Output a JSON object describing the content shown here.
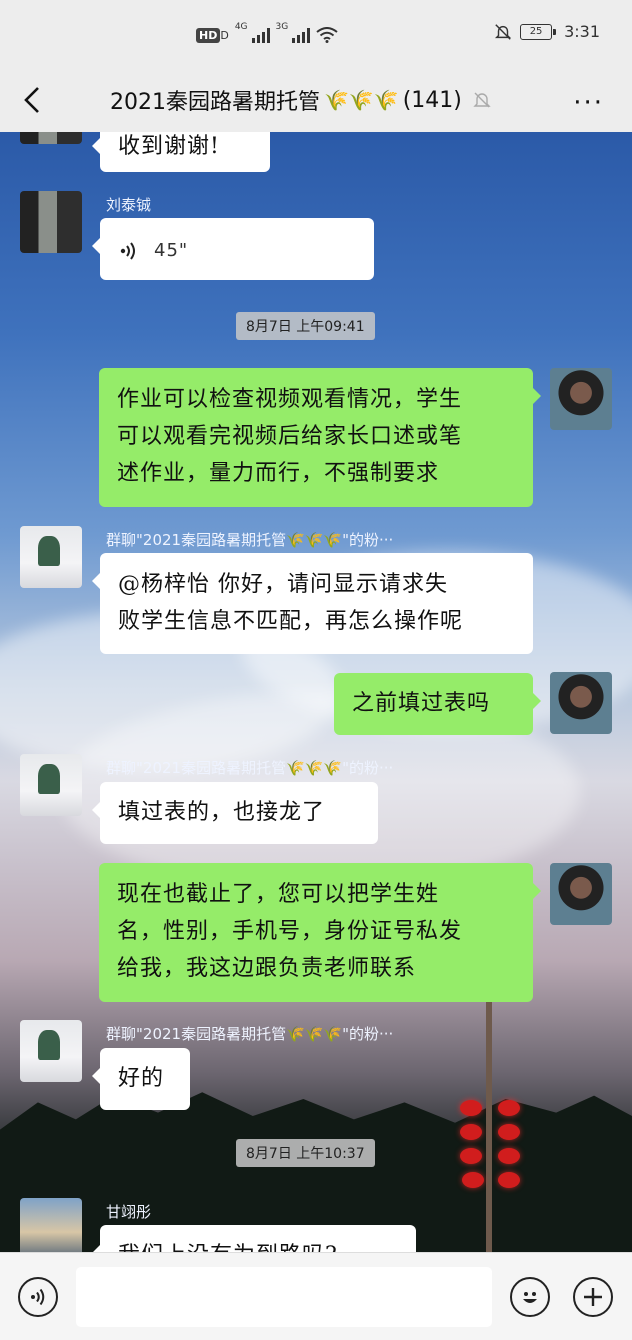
{
  "status_bar": {
    "network_badge": "HD",
    "network_sub": "D",
    "net1": "4G",
    "net2": "3G",
    "battery": "25",
    "time": "3:31"
  },
  "header": {
    "title": "2021秦园路暑期托管",
    "member_count": "(141)",
    "back_icon": "chevron-left-icon",
    "more_icon": "ellipsis-icon",
    "more_label": "···"
  },
  "messages": [
    {
      "side": "left",
      "sender": "",
      "text": "收到谢谢!"
    },
    {
      "side": "left",
      "sender": "刘泰铖",
      "type": "voice",
      "duration": "45\""
    },
    {
      "type": "timestamp",
      "text": "8月7日 上午09:41"
    },
    {
      "side": "right",
      "lines": [
        "作业可以检查视频观看情况，学生",
        "可以观看完视频后给家长口述或笔",
        "述作业，量力而行，不强制要求"
      ]
    },
    {
      "side": "left",
      "sender": "群聊\"2021秦园路暑期托管🌾🌾🌾\"的粉···",
      "lines": [
        "@杨梓怡  你好，请问显示请求失",
        "败学生信息不匹配，再怎么操作呢"
      ]
    },
    {
      "side": "right",
      "text": "之前填过表吗"
    },
    {
      "side": "left",
      "sender": "群聊\"2021秦园路暑期托管🌾🌾🌾\"的粉···",
      "text": "填过表的，也接龙了"
    },
    {
      "side": "right",
      "lines": [
        "现在也截止了，您可以把学生姓",
        "名，性别，手机号，身份证号私发",
        "给我，我这边跟负责老师联系"
      ]
    },
    {
      "side": "left",
      "sender": "群聊\"2021秦园路暑期托管🌾🌾🌾\"的粉···",
      "text": "好的"
    },
    {
      "type": "timestamp",
      "text": "8月7日 上午10:37"
    },
    {
      "side": "left",
      "sender": "甘翊彤",
      "text": "我们上没有为到路吗?"
    }
  ],
  "input_bar": {
    "voice_icon": "voice-icon",
    "emoji_icon": "emoji-icon",
    "add_icon": "plus-icon",
    "placeholder": ""
  }
}
